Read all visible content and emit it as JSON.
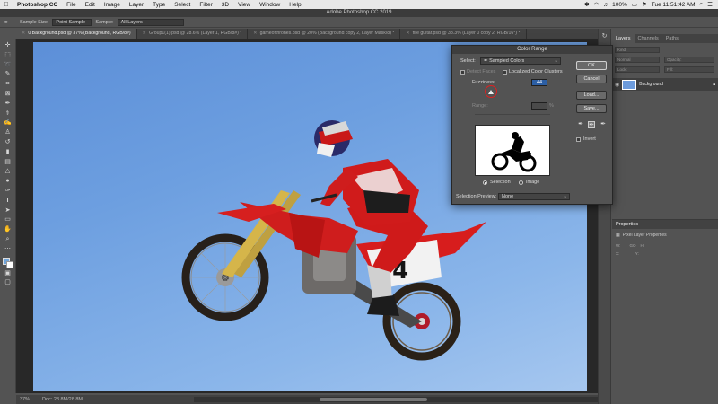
{
  "menubar": {
    "apple": "",
    "app": "Photoshop CC",
    "items": [
      "File",
      "Edit",
      "Image",
      "Layer",
      "Type",
      "Select",
      "Filter",
      "3D",
      "View",
      "Window",
      "Help"
    ],
    "battery": "100%",
    "clock": "Tue 11:51:42 AM"
  },
  "window": {
    "title": "Adobe Photoshop CC 2019"
  },
  "options": {
    "sample_size_label": "Sample Size:",
    "sample_size_value": "Point Sample",
    "sample_label": "Sample:",
    "sample_value": "All Layers"
  },
  "tabs": [
    {
      "label": "0 Background.psd @ 37% (Background, RGB/8#)",
      "active": true
    },
    {
      "label": "Group1(1).psd @ 28.6% (Layer 1, RGB/8#) *",
      "active": false
    },
    {
      "label": "gameofthrones.psd @ 20% (Background copy 2, Layer Mask/8) *",
      "active": false
    },
    {
      "label": "fire guitar.psd @ 38.3% (Layer 0 copy 2, RGB/16*) *",
      "active": false
    }
  ],
  "status": {
    "zoom": "37%",
    "doc": "Doc: 28.8M/28.8M"
  },
  "layers_panel": {
    "tabs": [
      "Layers",
      "Channels",
      "Paths"
    ],
    "kind": "Kind",
    "blend": "Normal",
    "opacity": "Opacity:",
    "lock": "Lock:",
    "fill": "Fill:",
    "layer_name": "Background"
  },
  "properties_panel": {
    "title": "Properties",
    "subtitle": "Pixel Layer Properties",
    "w_label": "W:",
    "h_label": "H:",
    "x_label": "X:",
    "y_label": "Y:",
    "go_label": "GO"
  },
  "dialog": {
    "title": "Color Range",
    "select_label": "Select:",
    "select_value": "Sampled Colors",
    "detect_faces": "Detect Faces",
    "localized": "Localized Color Clusters",
    "fuzziness_label": "Fuzziness:",
    "fuzziness_value": "44",
    "range_label": "Range:",
    "range_unit": "%",
    "fuzziness_fraction": 0.22,
    "radio_selection": "Selection",
    "radio_image": "Image",
    "selection_preview_label": "Selection Preview:",
    "selection_preview_value": "None",
    "ok": "OK",
    "cancel": "Cancel",
    "load": "Load...",
    "save": "Save...",
    "invert": "Invert"
  },
  "photo": {
    "number": "34"
  }
}
